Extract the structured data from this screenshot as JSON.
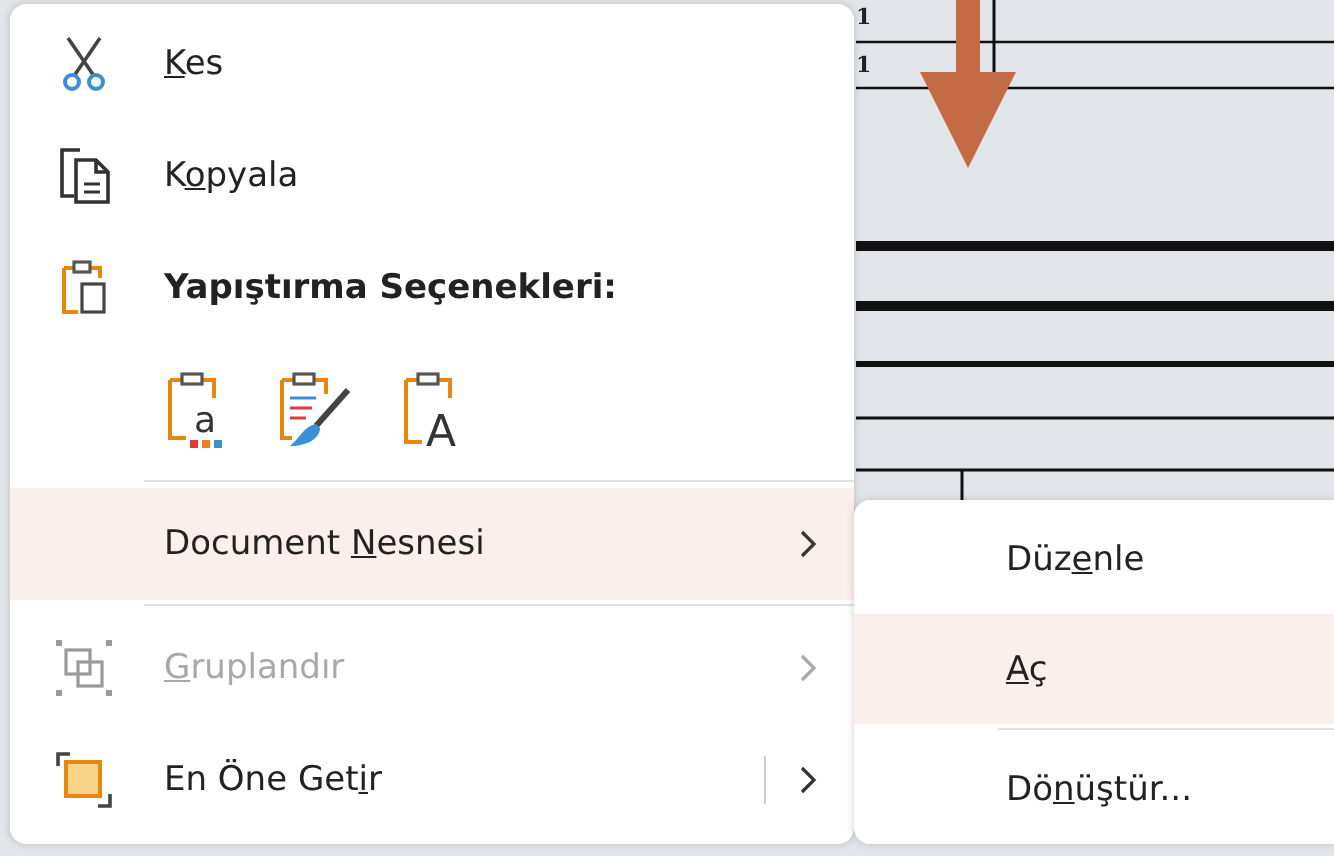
{
  "document": {
    "cells": [
      "1",
      "1"
    ]
  },
  "context_menu": {
    "items": [
      {
        "kind": "command",
        "key": "K",
        "after": "es",
        "selected": false,
        "disabled": false,
        "submenu": false,
        "split": false
      },
      {
        "kind": "command",
        "before": "K",
        "key": "o",
        "after": "pyala",
        "selected": false,
        "disabled": false,
        "submenu": false,
        "split": false
      },
      {
        "kind": "header",
        "label": "Yapıştırma Seçenekleri:"
      },
      {
        "kind": "paste_options",
        "options": [
          {
            "kind": "keep_source",
            "glyph": "a"
          },
          {
            "kind": "merge"
          },
          {
            "kind": "text_only",
            "glyph": "A"
          }
        ]
      },
      {
        "kind": "separator"
      },
      {
        "kind": "command",
        "before": "Document ",
        "key": "N",
        "after": "esnesi",
        "selected": true,
        "disabled": false,
        "submenu": true,
        "split": false
      },
      {
        "kind": "separator"
      },
      {
        "kind": "command",
        "key": "G",
        "after": "ruplandır",
        "selected": false,
        "disabled": true,
        "submenu": true,
        "split": false
      },
      {
        "kind": "command",
        "before": "En Öne Get",
        "key": "i",
        "after": "r",
        "selected": false,
        "disabled": false,
        "submenu": true,
        "split": true
      }
    ]
  },
  "submenu": {
    "items": [
      {
        "kind": "command",
        "before": "Düz",
        "key": "e",
        "after": "nle",
        "selected": false
      },
      {
        "kind": "command",
        "key": "A",
        "after": "ç",
        "selected": true
      },
      {
        "kind": "separator"
      },
      {
        "kind": "command",
        "before": "Dö",
        "key": "n",
        "after": "üştür...",
        "selected": false
      }
    ]
  }
}
